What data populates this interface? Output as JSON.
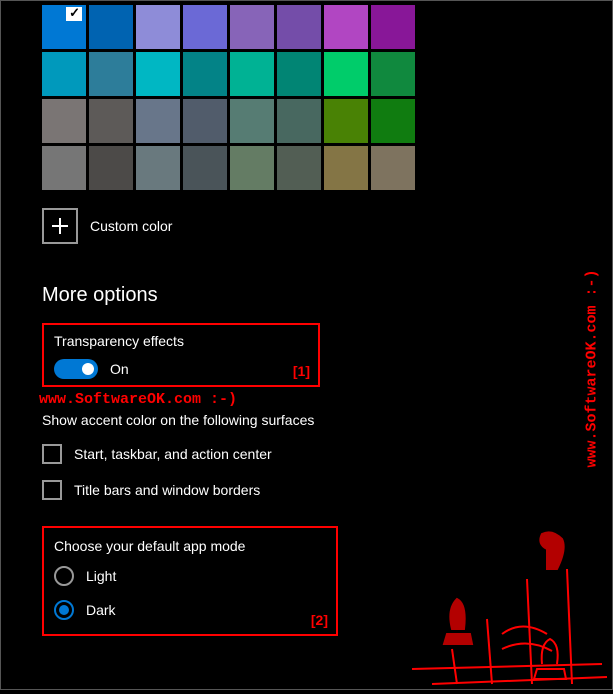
{
  "color_grid": {
    "rows": [
      [
        "#0078d4",
        "#0063b1",
        "#8e8cd8",
        "#6b69d6",
        "#8764b8",
        "#744da9",
        "#b146c2",
        "#881798"
      ],
      [
        "#0099bc",
        "#2d7d9a",
        "#00b7c3",
        "#038387",
        "#00b294",
        "#018574",
        "#00cc6a",
        "#10893e"
      ],
      [
        "#7a7574",
        "#5d5a58",
        "#68768a",
        "#515c6b",
        "#567c73",
        "#486860",
        "#498205",
        "#107c10"
      ],
      [
        "#767676",
        "#4c4a48",
        "#69797e",
        "#4a5459",
        "#647c64",
        "#525e54",
        "#847545",
        "#7e735f"
      ]
    ],
    "selected_index": [
      0,
      0
    ]
  },
  "custom_color_label": "Custom color",
  "more_options_heading": "More options",
  "transparency": {
    "label": "Transparency effects",
    "state": "On",
    "annotation": "[1]"
  },
  "watermark": "www.SoftwareOK.com :-)",
  "accent_surfaces": {
    "heading": "Show accent color on the following surfaces",
    "options": [
      {
        "label": "Start, taskbar, and action center",
        "checked": false
      },
      {
        "label": "Title bars and window borders",
        "checked": false
      }
    ]
  },
  "app_mode": {
    "heading": "Choose your default app mode",
    "options": [
      {
        "label": "Light",
        "selected": false
      },
      {
        "label": "Dark",
        "selected": true
      }
    ],
    "annotation": "[2]"
  }
}
